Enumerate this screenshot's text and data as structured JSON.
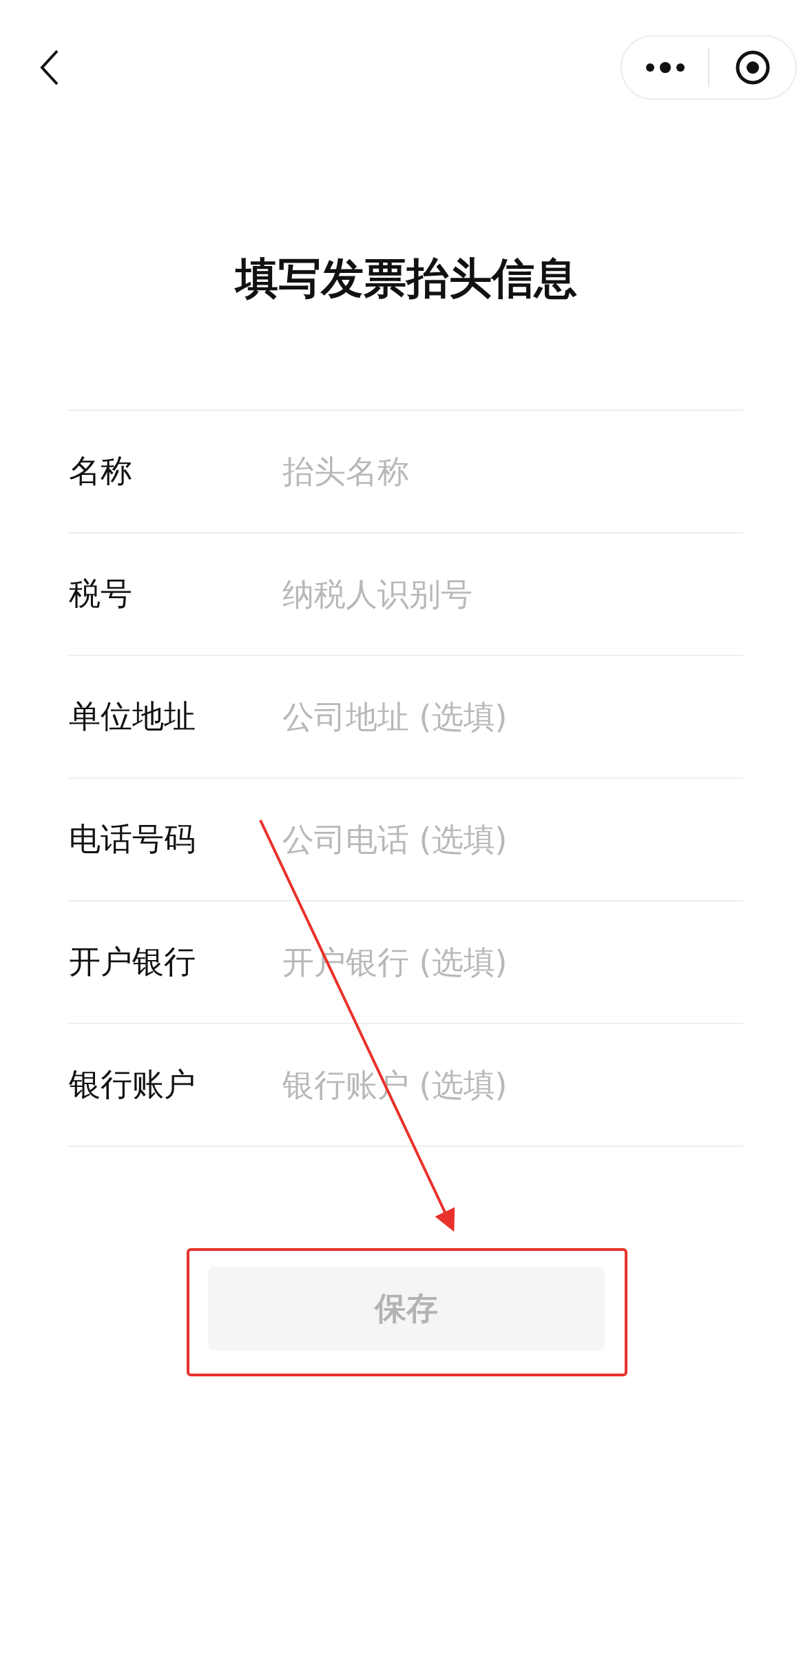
{
  "title": "填写发票抬头信息",
  "fields": [
    {
      "label": "名称",
      "placeholder": "抬头名称"
    },
    {
      "label": "税号",
      "placeholder": "纳税人识别号"
    },
    {
      "label": "单位地址",
      "placeholder": "公司地址 (选填)"
    },
    {
      "label": "电话号码",
      "placeholder": "公司电话 (选填)"
    },
    {
      "label": "开户银行",
      "placeholder": "开户银行 (选填)"
    },
    {
      "label": "银行账户",
      "placeholder": "银行账户 (选填)"
    }
  ],
  "save_button": {
    "label": "保存",
    "disabled": true
  }
}
